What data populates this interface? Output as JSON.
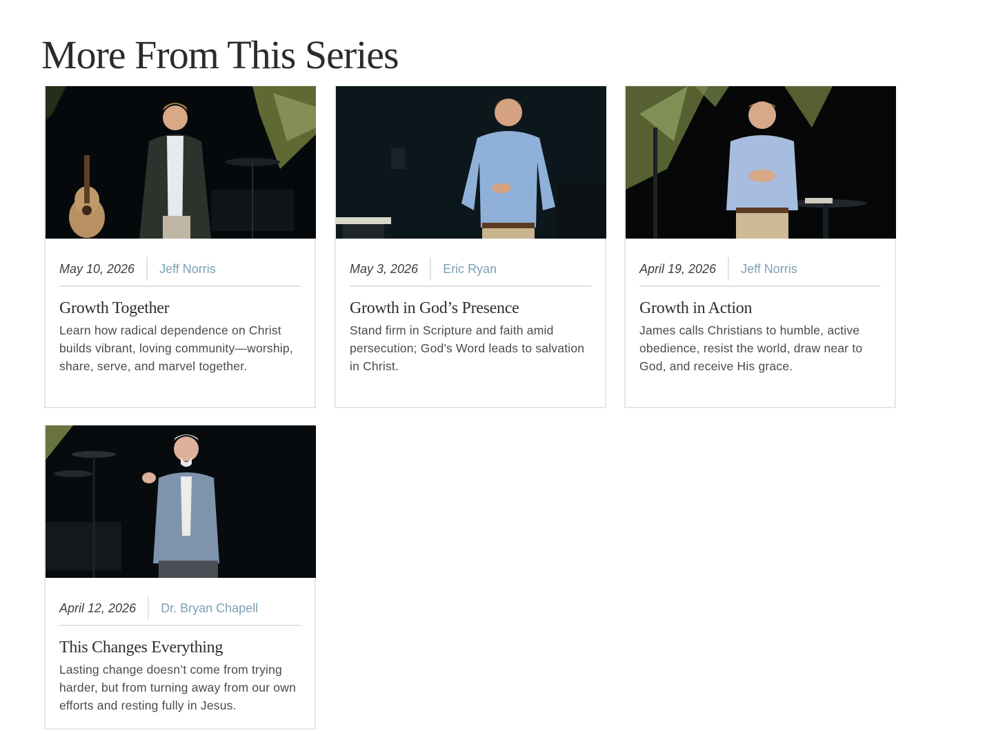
{
  "section": {
    "title": "More From This Series"
  },
  "cards": [
    {
      "date": "May 10, 2026",
      "speaker": "Jeff Norris",
      "title": "Growth Together",
      "description": "Learn how radical dependence on Christ builds vibrant, loving community—worship, share, serve, and marvel together.",
      "image_alt": "speaker-on-stage-with-guitar"
    },
    {
      "date": "May 3, 2026",
      "speaker": "Eric Ryan",
      "title": "Growth in God’s Presence",
      "description": "Stand firm in Scripture and faith amid persecution; God's Word leads to salvation in Christ.",
      "image_alt": "speaker-on-stage-blue-shirt"
    },
    {
      "date": "April 19, 2026",
      "speaker": "Jeff Norris",
      "title": "Growth in Action",
      "description": "James calls Christians to humble, active obedience, resist the world, draw near to God, and receive His grace.",
      "image_alt": "speaker-on-stage-hands-clasped"
    },
    {
      "date": "April 12, 2026",
      "speaker": "Dr. Bryan Chapell",
      "title": "This Changes Everything",
      "description": "Lasting change doesn’t come from trying harder, but from turning away from our own efforts and resting fully in Jesus.",
      "image_alt": "speaker-on-stage-gesturing"
    }
  ],
  "colors": {
    "speaker_link": "#7aa2b6",
    "card_border": "#e6e6e6",
    "title_text": "#2b2b2b"
  }
}
